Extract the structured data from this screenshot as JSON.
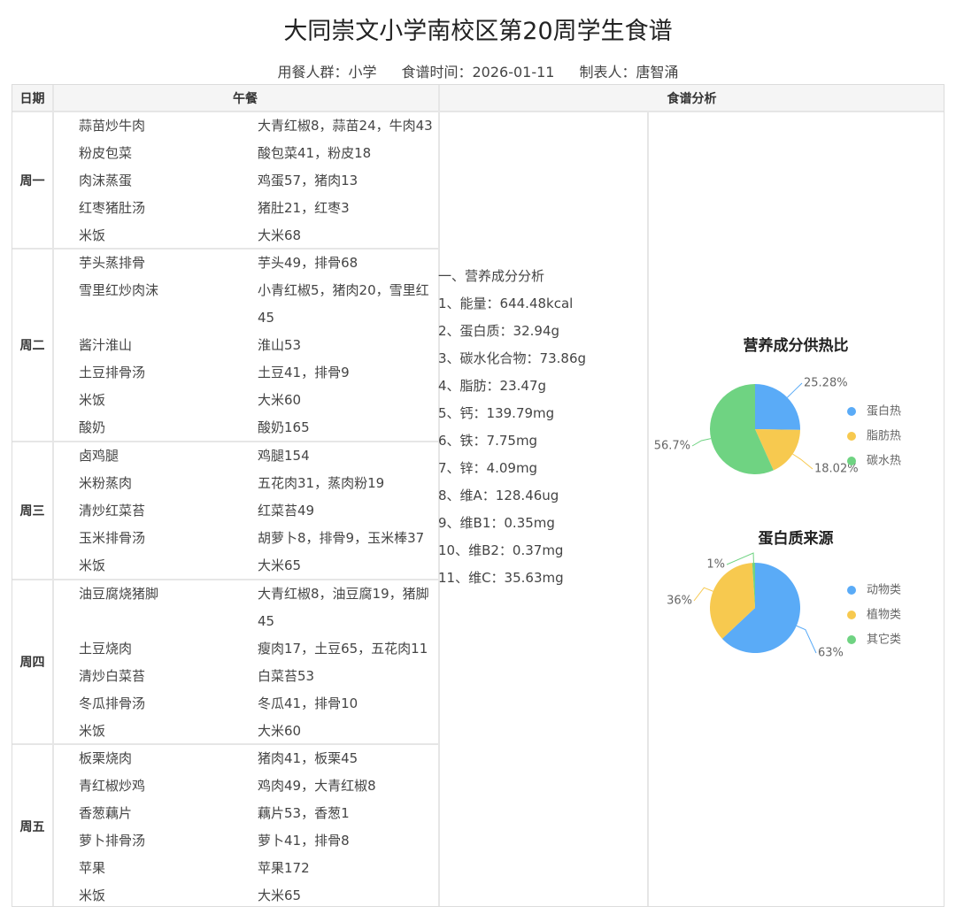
{
  "title": "大同崇文小学南校区第20周学生食谱",
  "subtitle": {
    "group": "用餐人群：小学",
    "date": "食谱时间：2026-01-11",
    "author": "制表人：唐智涌"
  },
  "headers": {
    "day": "日期",
    "lunch": "午餐",
    "analysis": "食谱分析"
  },
  "days": [
    {
      "label": "周一",
      "items": [
        {
          "dish": "蒜苗炒牛肉",
          "ingredients": "大青红椒8，蒜苗24，牛肉43"
        },
        {
          "dish": "粉皮包菜",
          "ingredients": "酸包菜41，粉皮18"
        },
        {
          "dish": "肉沫蒸蛋",
          "ingredients": "鸡蛋57，猪肉13"
        },
        {
          "dish": "红枣猪肚汤",
          "ingredients": "猪肚21，红枣3"
        },
        {
          "dish": "米饭",
          "ingredients": "大米68"
        }
      ]
    },
    {
      "label": "周二",
      "items": [
        {
          "dish": "芋头蒸排骨",
          "ingredients": "芋头49，排骨68"
        },
        {
          "dish": "雪里红炒肉沫",
          "ingredients": "小青红椒5，猪肉20，雪里红45"
        },
        {
          "dish": "酱汁淮山",
          "ingredients": "淮山53"
        },
        {
          "dish": "土豆排骨汤",
          "ingredients": "土豆41，排骨9"
        },
        {
          "dish": "米饭",
          "ingredients": "大米60"
        },
        {
          "dish": "酸奶",
          "ingredients": "酸奶165"
        }
      ]
    },
    {
      "label": "周三",
      "items": [
        {
          "dish": "卤鸡腿",
          "ingredients": "鸡腿154"
        },
        {
          "dish": "米粉蒸肉",
          "ingredients": "五花肉31，蒸肉粉19"
        },
        {
          "dish": "清炒红菜苔",
          "ingredients": "红菜苔49"
        },
        {
          "dish": "玉米排骨汤",
          "ingredients": "胡萝卜8，排骨9，玉米棒37"
        },
        {
          "dish": "米饭",
          "ingredients": "大米65"
        }
      ]
    },
    {
      "label": "周四",
      "items": [
        {
          "dish": "油豆腐烧猪脚",
          "ingredients": "大青红椒8，油豆腐19，猪脚45"
        },
        {
          "dish": "土豆烧肉",
          "ingredients": "瘦肉17，土豆65，五花肉11"
        },
        {
          "dish": "清炒白菜苔",
          "ingredients": "白菜苔53"
        },
        {
          "dish": "冬瓜排骨汤",
          "ingredients": "冬瓜41，排骨10"
        },
        {
          "dish": "米饭",
          "ingredients": "大米60"
        }
      ]
    },
    {
      "label": "周五",
      "items": [
        {
          "dish": "板栗烧肉",
          "ingredients": "猪肉41，板栗45"
        },
        {
          "dish": "青红椒炒鸡",
          "ingredients": "鸡肉49，大青红椒8"
        },
        {
          "dish": "香葱藕片",
          "ingredients": "藕片53，香葱1"
        },
        {
          "dish": "萝卜排骨汤",
          "ingredients": "萝卜41，排骨8"
        },
        {
          "dish": "苹果",
          "ingredients": "苹果172"
        },
        {
          "dish": "米饭",
          "ingredients": "大米65"
        }
      ]
    }
  ],
  "analysis": [
    "一、营养成分分析",
    "1、能量：644.48kcal",
    "2、蛋白质：32.94g",
    "3、碳水化合物：73.86g",
    "4、脂肪：23.47g",
    "5、钙：139.79mg",
    "6、铁：7.75mg",
    "7、锌：4.09mg",
    "8、维A：128.46ug",
    "9、维B1：0.35mg",
    "10、维B2：0.37mg",
    "11、维C：35.63mg"
  ],
  "colors": {
    "blue": "#5aabf7",
    "yellow": "#f7c94f",
    "green": "#6fd382"
  },
  "chart_data": [
    {
      "type": "pie",
      "title": "营养成分供热比",
      "categories": [
        "蛋白热",
        "脂肪热",
        "碳水热"
      ],
      "values": [
        25.28,
        18.02,
        56.7
      ],
      "value_labels": [
        "25.28%",
        "18.02%",
        "56.7%"
      ],
      "colors": [
        "#5aabf7",
        "#f7c94f",
        "#6fd382"
      ],
      "legend": "right"
    },
    {
      "type": "pie",
      "title": "蛋白质来源",
      "categories": [
        "动物类",
        "植物类",
        "其它类"
      ],
      "values": [
        63,
        36,
        1
      ],
      "value_labels": [
        "63%",
        "36%",
        "1%"
      ],
      "colors": [
        "#5aabf7",
        "#f7c94f",
        "#6fd382"
      ],
      "legend": "right"
    }
  ]
}
